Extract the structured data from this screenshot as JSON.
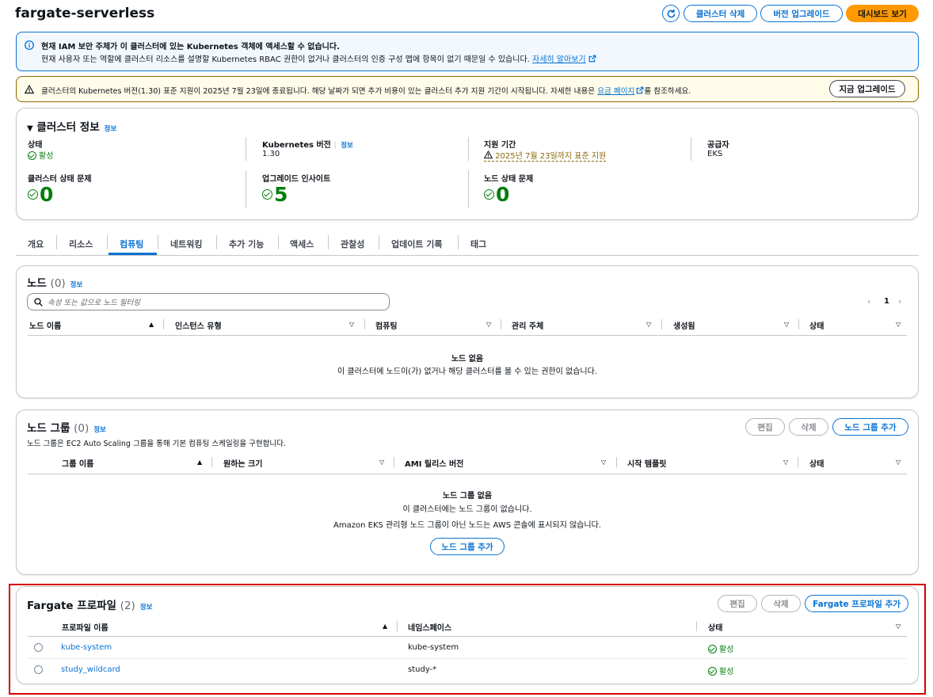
{
  "header": {
    "title": "fargate-serverless",
    "buttons": {
      "delete_cluster": "클러스터 삭제",
      "upgrade_version": "버전 업그레이드",
      "view_dashboard": "대시보드 보기"
    }
  },
  "info_banner": {
    "line1": "현재 IAM 보안 주체가 이 클러스터에 있는 Kubernetes 객체에 액세스할 수 없습니다.",
    "line2": "현재 사용자 또는 역할에 클러스터 리소스를 설명할 Kubernetes RBAC 권한이 없거나 클러스터의 인증 구성 맵에 항목이 없기 때문일 수 있습니다.",
    "link": "자세히 알아보기"
  },
  "warning_banner": {
    "text_before": "클러스터의 Kubernetes 버전(1.30) 표준 지원이 2025년 7월 23일에 종료됩니다. 해당 날짜가 되면 추가 비용이 있는 클러스터 추가 지원 기간이 시작됩니다. 자세한 내용은",
    "link": "요금 페이지",
    "text_after": "를 참조하세요.",
    "button": "지금 업그레이드"
  },
  "cluster_info": {
    "title": "클러스터 정보",
    "info": "정보",
    "status_label": "상태",
    "status_value": "활성",
    "k8s_label": "Kubernetes 버전",
    "k8s_info": "정보",
    "k8s_value": "1.30",
    "support_label": "지원 기간",
    "support_value": "2025년 7월 23일까지 표준 지원",
    "provider_label": "공급자",
    "provider_value": "EKS",
    "health_label": "클러스터 상태 문제",
    "health_value": "0",
    "insights_label": "업그레이드 인사이트",
    "insights_value": "5",
    "node_health_label": "노드 상태 문제",
    "node_health_value": "0"
  },
  "tabs": [
    "개요",
    "리소스",
    "컴퓨팅",
    "네트워킹",
    "추가 기능",
    "액세스",
    "관찰성",
    "업데이트 기록",
    "태그"
  ],
  "nodes": {
    "title": "노드",
    "count": "(0)",
    "info": "정보",
    "filter_placeholder": "속성 또는 값으로 노드 필터링",
    "page": "1",
    "columns": [
      "노드 이름",
      "인스턴스 유형",
      "컴퓨팅",
      "관리 주체",
      "생성됨",
      "상태"
    ],
    "empty_title": "노드 없음",
    "empty_desc": "이 클러스터에 노드이(가) 없거나 해당 클러스터를 볼 수 있는 권한이 없습니다."
  },
  "node_groups": {
    "title": "노드 그룹",
    "count": "(0)",
    "info": "정보",
    "description": "노드 그룹은 EC2 Auto Scaling 그룹을 통해 기본 컴퓨팅 스케일링을 구현합니다.",
    "edit": "편집",
    "delete": "삭제",
    "add": "노드 그룹 추가",
    "columns": [
      "그룹 이름",
      "원하는 크기",
      "AMI 릴리스 버전",
      "시작 템플릿",
      "상태"
    ],
    "empty_title": "노드 그룹 없음",
    "empty_desc1": "이 클러스터에는 노드 그룹이 없습니다.",
    "empty_desc2": "Amazon EKS 관리형 노드 그룹이 아닌 노드는 AWS 콘솔에 표시되지 않습니다.",
    "empty_add": "노드 그룹 추가"
  },
  "fargate": {
    "title": "Fargate 프로파일",
    "count": "(2)",
    "info": "정보",
    "edit": "편집",
    "delete": "삭제",
    "add": "Fargate 프로파일 추가",
    "columns": [
      "프로파일 이름",
      "네임스페이스",
      "상태"
    ],
    "rows": [
      {
        "name": "kube-system",
        "namespace": "kube-system",
        "status": "활성"
      },
      {
        "name": "study_wildcard",
        "namespace": "study-*",
        "status": "활성"
      }
    ]
  }
}
